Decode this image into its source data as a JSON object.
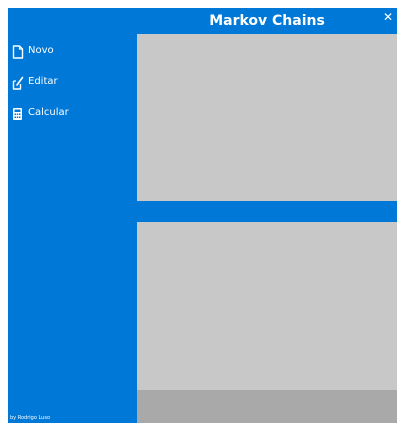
{
  "app": {
    "title": "Markov Chains",
    "close_glyph": "✕"
  },
  "sidebar": {
    "items": [
      {
        "label": "Novo",
        "icon": "new-document-icon"
      },
      {
        "label": "Editar",
        "icon": "edit-icon"
      },
      {
        "label": "Calcular",
        "icon": "calculator-icon"
      }
    ],
    "credit": "by Rodrigo Luso"
  },
  "colors": {
    "primary": "#0078d7",
    "panel": "#c8c8c8",
    "status_bar": "#a9a9a9",
    "text": "#ffffff"
  }
}
